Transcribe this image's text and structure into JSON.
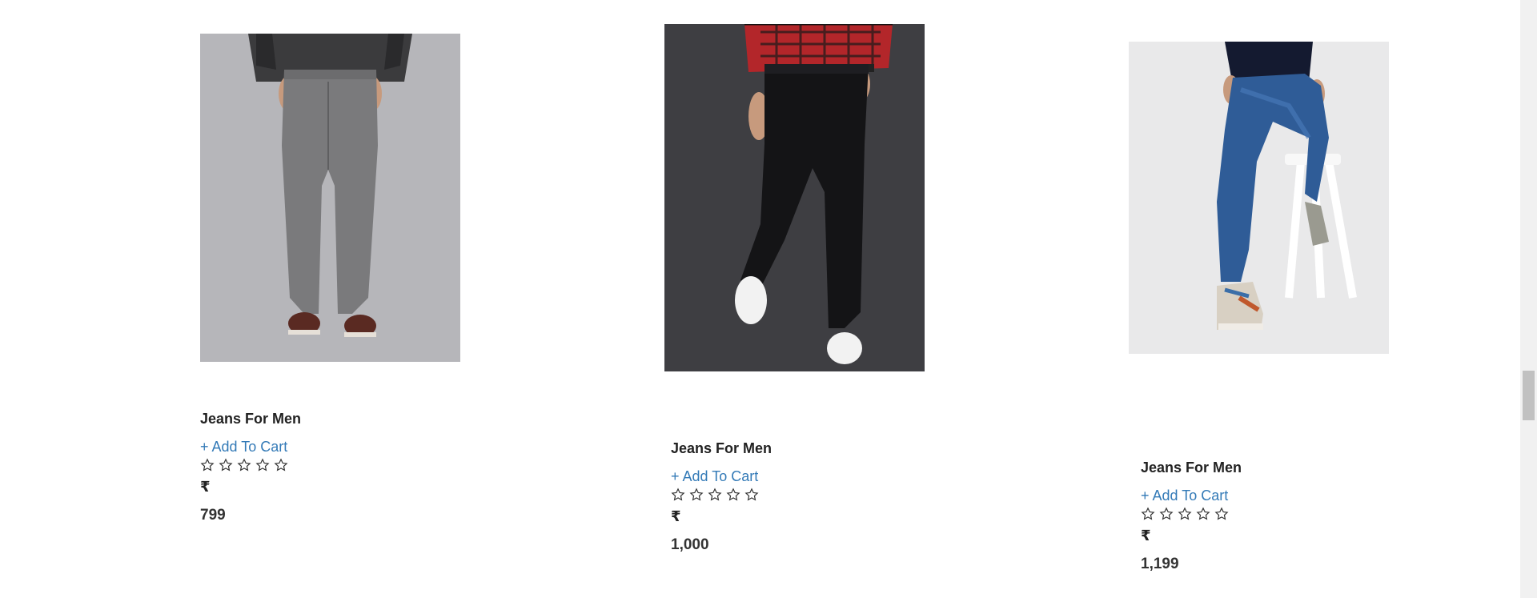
{
  "products": [
    {
      "title": "Jeans For Men",
      "add_to_cart": "+ Add To Cart",
      "currency": "₹",
      "price": "799",
      "rating_stars": 5,
      "rating_value": 0,
      "image_alt": "grey-jeans-photo"
    },
    {
      "title": "Jeans For Men",
      "add_to_cart": "+ Add To Cart",
      "currency": "₹",
      "price": "1,000",
      "rating_stars": 5,
      "rating_value": 0,
      "image_alt": "black-jeans-photo"
    },
    {
      "title": "Jeans For Men",
      "add_to_cart": "+ Add To Cart",
      "currency": "₹",
      "price": "1,199",
      "rating_stars": 5,
      "rating_value": 0,
      "image_alt": "blue-jeans-photo"
    }
  ],
  "colors": {
    "link": "#337ab7",
    "text": "#222222"
  },
  "icons": {
    "star": "star-outline-icon"
  }
}
